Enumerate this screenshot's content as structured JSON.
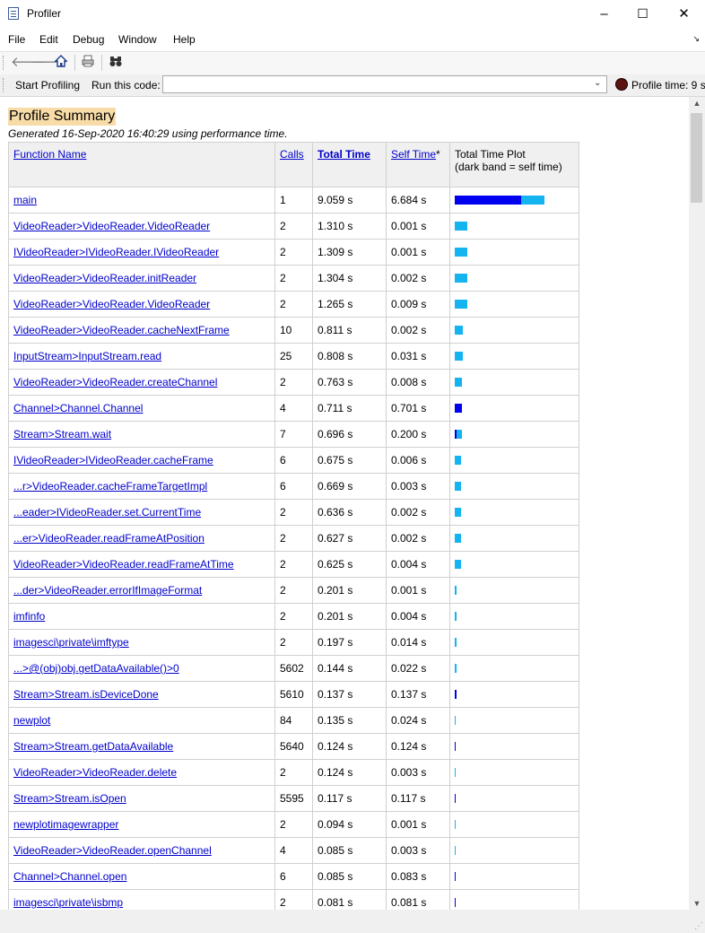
{
  "window": {
    "title": "Profiler",
    "controls": [
      "–",
      "☐",
      "✕"
    ]
  },
  "menu": [
    "File",
    "Edit",
    "Debug",
    "Window",
    "Help"
  ],
  "runbar": {
    "start_label": "Start Profiling",
    "run_label": "Run this code:",
    "run_value": "",
    "profile_time_label": "Profile time: 9 s"
  },
  "summary": {
    "title": "Profile Summary",
    "generated": "Generated 16-Sep-2020 16:40:29 using performance time.",
    "headers": {
      "function_name": "Function Name",
      "calls": "Calls",
      "total_time": "Total Time",
      "self_time": "Self Time",
      "self_time_note": "*",
      "plot_line1": "Total Time Plot",
      "plot_line2": "(dark band = self time)"
    },
    "max_total_s": 9.059,
    "rows": [
      {
        "name": "main",
        "calls": "1",
        "total": "9.059 s",
        "self": "6.684 s",
        "total_s": 9.059,
        "self_s": 6.684
      },
      {
        "name": "VideoReader>VideoReader.VideoReader",
        "calls": "2",
        "total": "1.310 s",
        "self": "0.001 s",
        "total_s": 1.31,
        "self_s": 0.001
      },
      {
        "name": "IVideoReader>IVideoReader.IVideoReader",
        "calls": "2",
        "total": "1.309 s",
        "self": "0.001 s",
        "total_s": 1.309,
        "self_s": 0.001
      },
      {
        "name": "VideoReader>VideoReader.initReader",
        "calls": "2",
        "total": "1.304 s",
        "self": "0.002 s",
        "total_s": 1.304,
        "self_s": 0.002
      },
      {
        "name": "VideoReader>VideoReader.VideoReader",
        "calls": "2",
        "total": "1.265 s",
        "self": "0.009 s",
        "total_s": 1.265,
        "self_s": 0.009
      },
      {
        "name": "VideoReader>VideoReader.cacheNextFrame",
        "calls": "10",
        "total": "0.811 s",
        "self": "0.002 s",
        "total_s": 0.811,
        "self_s": 0.002
      },
      {
        "name": "InputStream>InputStream.read",
        "calls": "25",
        "total": "0.808 s",
        "self": "0.031 s",
        "total_s": 0.808,
        "self_s": 0.031
      },
      {
        "name": "VideoReader>VideoReader.createChannel",
        "calls": "2",
        "total": "0.763 s",
        "self": "0.008 s",
        "total_s": 0.763,
        "self_s": 0.008
      },
      {
        "name": "Channel>Channel.Channel",
        "calls": "4",
        "total": "0.711 s",
        "self": "0.701 s",
        "total_s": 0.711,
        "self_s": 0.701
      },
      {
        "name": "Stream>Stream.wait",
        "calls": "7",
        "total": "0.696 s",
        "self": "0.200 s",
        "total_s": 0.696,
        "self_s": 0.2
      },
      {
        "name": "IVideoReader>IVideoReader.cacheFrame",
        "calls": "6",
        "total": "0.675 s",
        "self": "0.006 s",
        "total_s": 0.675,
        "self_s": 0.006
      },
      {
        "name": "...r>VideoReader.cacheFrameTargetImpl",
        "calls": "6",
        "total": "0.669 s",
        "self": "0.003 s",
        "total_s": 0.669,
        "self_s": 0.003
      },
      {
        "name": "...eader>IVideoReader.set.CurrentTime",
        "calls": "2",
        "total": "0.636 s",
        "self": "0.002 s",
        "total_s": 0.636,
        "self_s": 0.002
      },
      {
        "name": "...er>VideoReader.readFrameAtPosition",
        "calls": "2",
        "total": "0.627 s",
        "self": "0.002 s",
        "total_s": 0.627,
        "self_s": 0.002
      },
      {
        "name": "VideoReader>VideoReader.readFrameAtTime",
        "calls": "2",
        "total": "0.625 s",
        "self": "0.004 s",
        "total_s": 0.625,
        "self_s": 0.004
      },
      {
        "name": "...der>VideoReader.errorIfImageFormat",
        "calls": "2",
        "total": "0.201 s",
        "self": "0.001 s",
        "total_s": 0.201,
        "self_s": 0.001
      },
      {
        "name": "imfinfo",
        "calls": "2",
        "total": "0.201 s",
        "self": "0.004 s",
        "total_s": 0.201,
        "self_s": 0.004
      },
      {
        "name": "imagesci\\private\\imftype",
        "calls": "2",
        "total": "0.197 s",
        "self": "0.014 s",
        "total_s": 0.197,
        "self_s": 0.014
      },
      {
        "name": "...>@(obj)obj.getDataAvailable()>0",
        "calls": "5602",
        "total": "0.144 s",
        "self": "0.022 s",
        "total_s": 0.144,
        "self_s": 0.022
      },
      {
        "name": "Stream>Stream.isDeviceDone",
        "calls": "5610",
        "total": "0.137 s",
        "self": "0.137 s",
        "total_s": 0.137,
        "self_s": 0.137
      },
      {
        "name": "newplot",
        "calls": "84",
        "total": "0.135 s",
        "self": "0.024 s",
        "total_s": 0.135,
        "self_s": 0.024
      },
      {
        "name": "Stream>Stream.getDataAvailable",
        "calls": "5640",
        "total": "0.124 s",
        "self": "0.124 s",
        "total_s": 0.124,
        "self_s": 0.124
      },
      {
        "name": "VideoReader>VideoReader.delete",
        "calls": "2",
        "total": "0.124 s",
        "self": "0.003 s",
        "total_s": 0.124,
        "self_s": 0.003
      },
      {
        "name": "Stream>Stream.isOpen",
        "calls": "5595",
        "total": "0.117 s",
        "self": "0.117 s",
        "total_s": 0.117,
        "self_s": 0.117
      },
      {
        "name": "newplotimagewrapper",
        "calls": "2",
        "total": "0.094 s",
        "self": "0.001 s",
        "total_s": 0.094,
        "self_s": 0.001
      },
      {
        "name": "VideoReader>VideoReader.openChannel",
        "calls": "4",
        "total": "0.085 s",
        "self": "0.003 s",
        "total_s": 0.085,
        "self_s": 0.003
      },
      {
        "name": "Channel>Channel.open",
        "calls": "6",
        "total": "0.085 s",
        "self": "0.083 s",
        "total_s": 0.085,
        "self_s": 0.083
      },
      {
        "name": "imagesci\\private\\isbmp",
        "calls": "2",
        "total": "0.081 s",
        "self": "0.081 s",
        "total_s": 0.081,
        "self_s": 0.081
      }
    ]
  },
  "colors": {
    "total_bar": "#14b4f0",
    "self_bar": "#0000f0",
    "link": "#0000cc",
    "title_highlight": "#f8dca8"
  }
}
